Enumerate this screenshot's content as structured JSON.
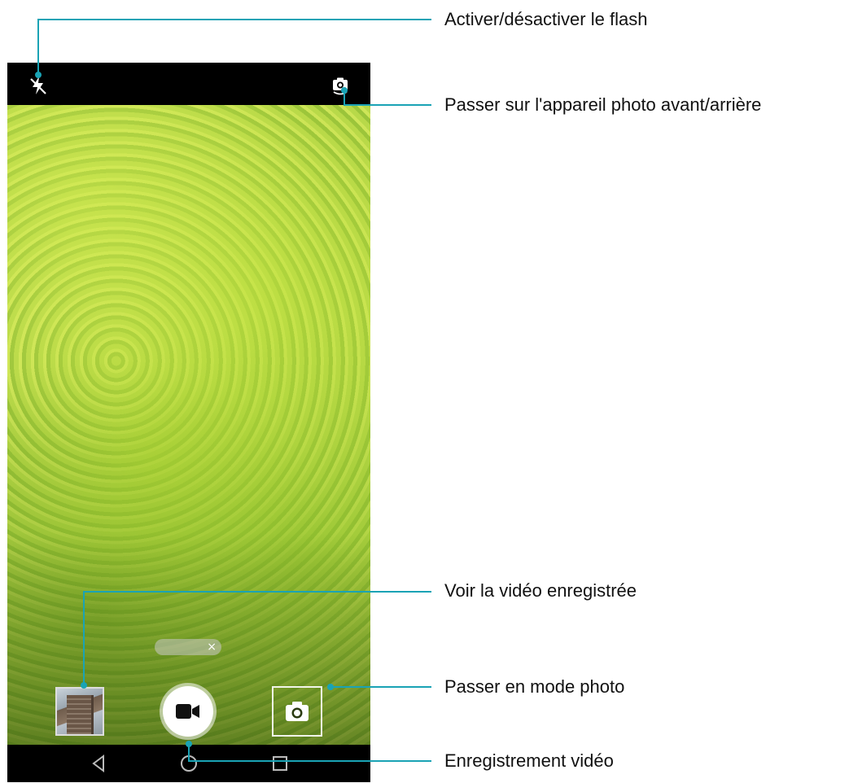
{
  "callouts": {
    "flash": "Activer/désactiver le flash",
    "switch_camera": "Passer sur l'appareil photo avant/arrière",
    "view_video": "Voir la vidéo enregistrée",
    "photo_mode": "Passer en mode photo",
    "record": "Enregistrement vidéo"
  },
  "camera": {
    "top_bar": {
      "flash_icon": "flash-off-icon",
      "switch_icon": "switch-camera-icon"
    },
    "chip_close": "×",
    "bottom_controls": {
      "thumbnail": "gallery-thumbnail",
      "record_icon": "video-camera-icon",
      "photo_icon": "camera-icon"
    },
    "nav": [
      "back-icon",
      "home-icon",
      "recents-icon"
    ]
  },
  "colors": {
    "callout_line": "#1aa3b5",
    "record_icon": "#111111",
    "bars": "#000000"
  }
}
